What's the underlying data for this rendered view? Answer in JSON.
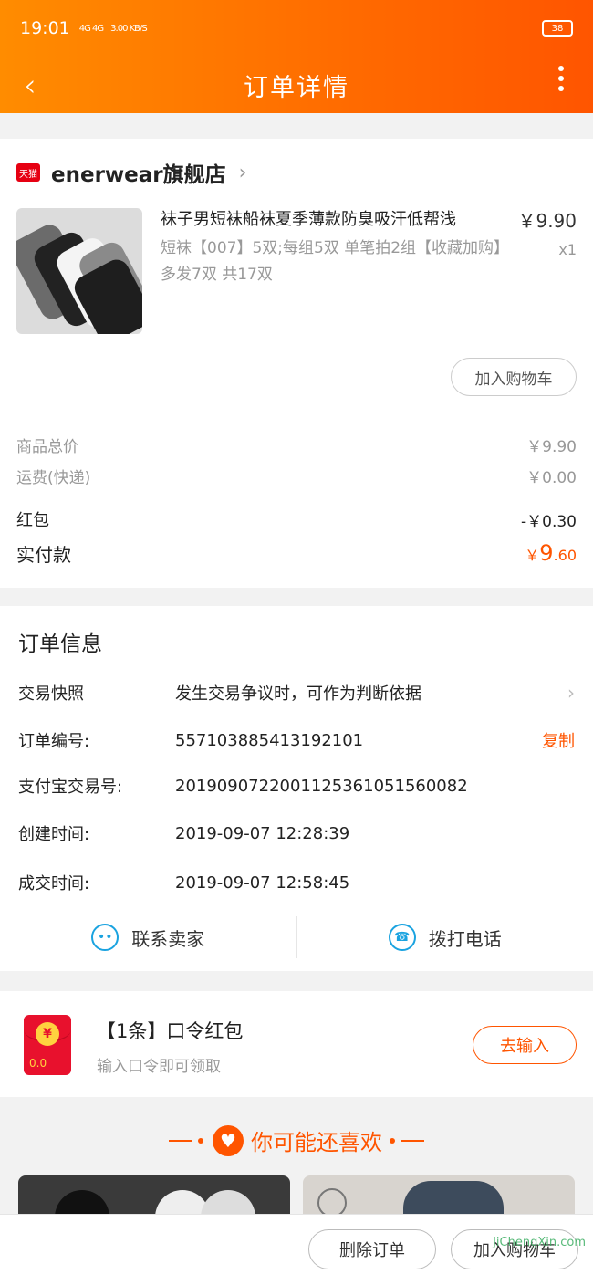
{
  "status_bar": {
    "time": "19:01",
    "net": "4G 4G",
    "speed": "3.00 KB/S",
    "battery": "38"
  },
  "nav": {
    "title": "订单详情"
  },
  "store": {
    "badge": "天猫",
    "name": "enerwear旗舰店"
  },
  "product": {
    "name": "袜子男短袜船袜夏季薄款防臭吸汗低帮浅",
    "sku": "短袜【007】5双;每组5双 单笔拍2组【收藏加购】多发7双 共17双",
    "price": "￥9.90",
    "qty": "x1",
    "add_cart_label": "加入购物车"
  },
  "price_summary": {
    "goods_total_label": "商品总价",
    "goods_total": "￥9.90",
    "shipping_label": "运费(快递)",
    "shipping": "￥0.00",
    "redpacket_label": "红包",
    "redpacket": "-￥0.30",
    "paid_label": "实付款",
    "paid_currency": "￥",
    "paid_int": "9",
    "paid_dec": ".60"
  },
  "order_info": {
    "title": "订单信息",
    "snapshot_label": "交易快照",
    "snapshot_value": "发生交易争议时，可作为判断依据",
    "order_no_label": "订单编号:",
    "order_no": "557103885413192101",
    "copy_label": "复制",
    "alipay_label": "支付宝交易号:",
    "alipay_no": "2019090722001125361051560082",
    "created_label": "创建时间:",
    "created": "2019-09-07 12:28:39",
    "deal_label": "成交时间:",
    "deal": "2019-09-07 12:58:45",
    "contact_seller": "联系卖家",
    "call_phone": "拨打电话"
  },
  "red_packet": {
    "title": "【1条】口令红包",
    "subtitle": "输入口令即可领取",
    "button": "去输入",
    "coin": "¥",
    "digits": "0.0"
  },
  "recommend": {
    "title": "你可能还喜欢"
  },
  "bottom": {
    "delete_label": "删除订单",
    "cart_label": "加入购物车"
  },
  "watermark": "JiChengXin.com",
  "colors": {
    "accent": "#ff5500",
    "header_start": "#ff8c00",
    "contact_icon": "#1aa3e0",
    "tmall": "#e60012"
  }
}
